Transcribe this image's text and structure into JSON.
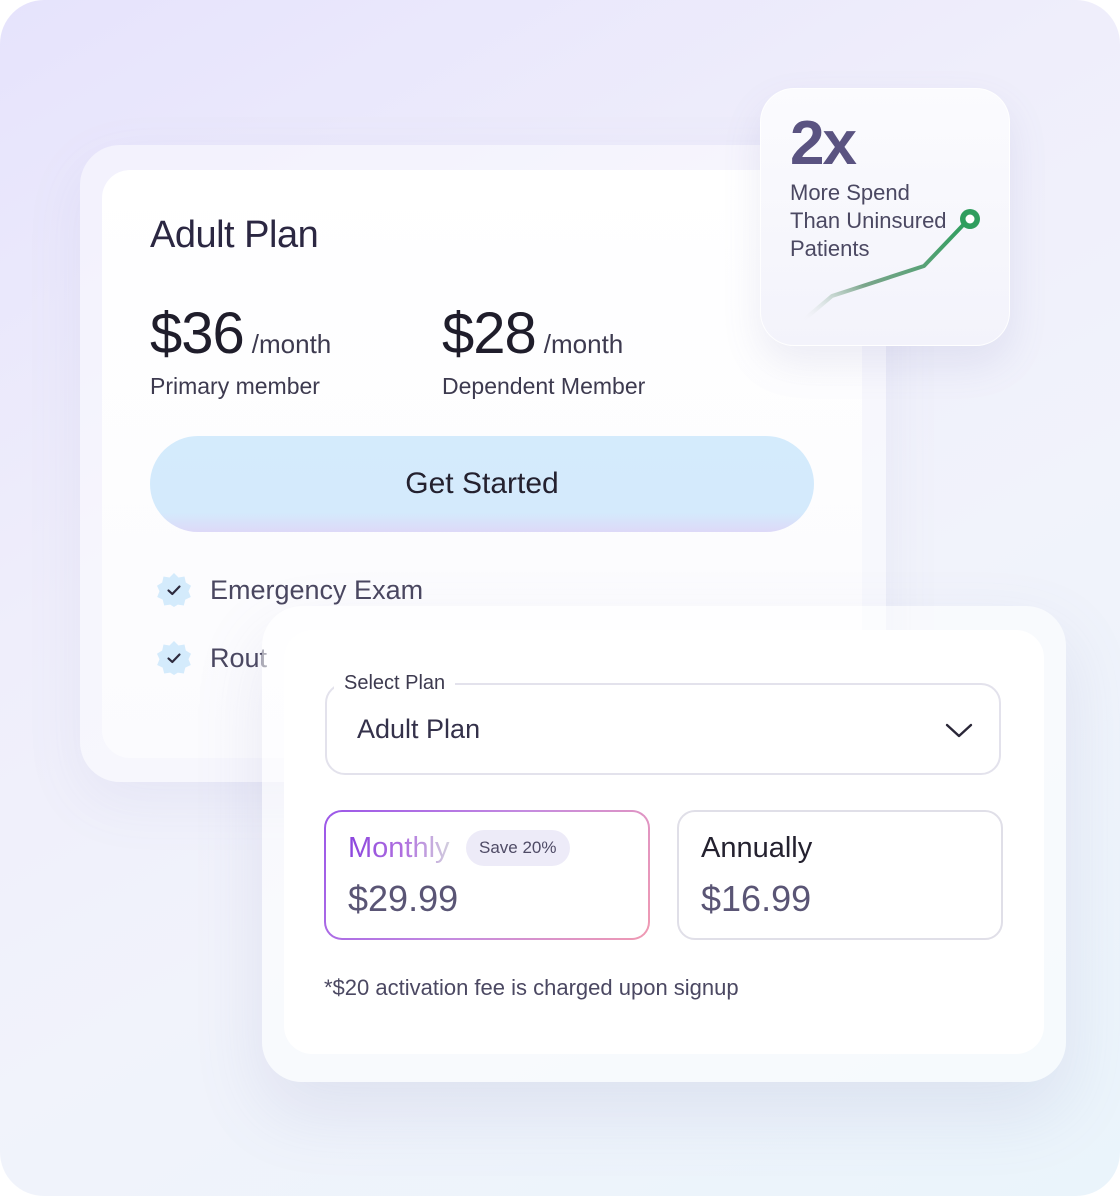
{
  "plan_card": {
    "title": "Adult Plan",
    "prices": [
      {
        "amount": "$36",
        "period": "/month",
        "label": "Primary member"
      },
      {
        "amount": "$28",
        "period": "/month",
        "label": "Dependent Member"
      }
    ],
    "cta_label": "Get Started",
    "features": [
      "Emergency Exam",
      "Rout"
    ]
  },
  "stat_card": {
    "value": "2x",
    "lines": [
      "More Spend",
      "Than Uninsured",
      "Patients"
    ],
    "trend_color": "#2f9e5e"
  },
  "select_card": {
    "select_label": "Select Plan",
    "selected_value": "Adult Plan",
    "options": [
      {
        "title": "Monthly",
        "price": "$29.99",
        "badge": "Save 20%",
        "selected": true
      },
      {
        "title": "Annually",
        "price": "$16.99",
        "selected": false
      }
    ],
    "fine_print": "*$20 activation fee is charged upon signup"
  },
  "colors": {
    "accent_purple": "#9b56e8",
    "cta_blue": "#d4ebfc",
    "check_badge": "#d4ebfc"
  }
}
